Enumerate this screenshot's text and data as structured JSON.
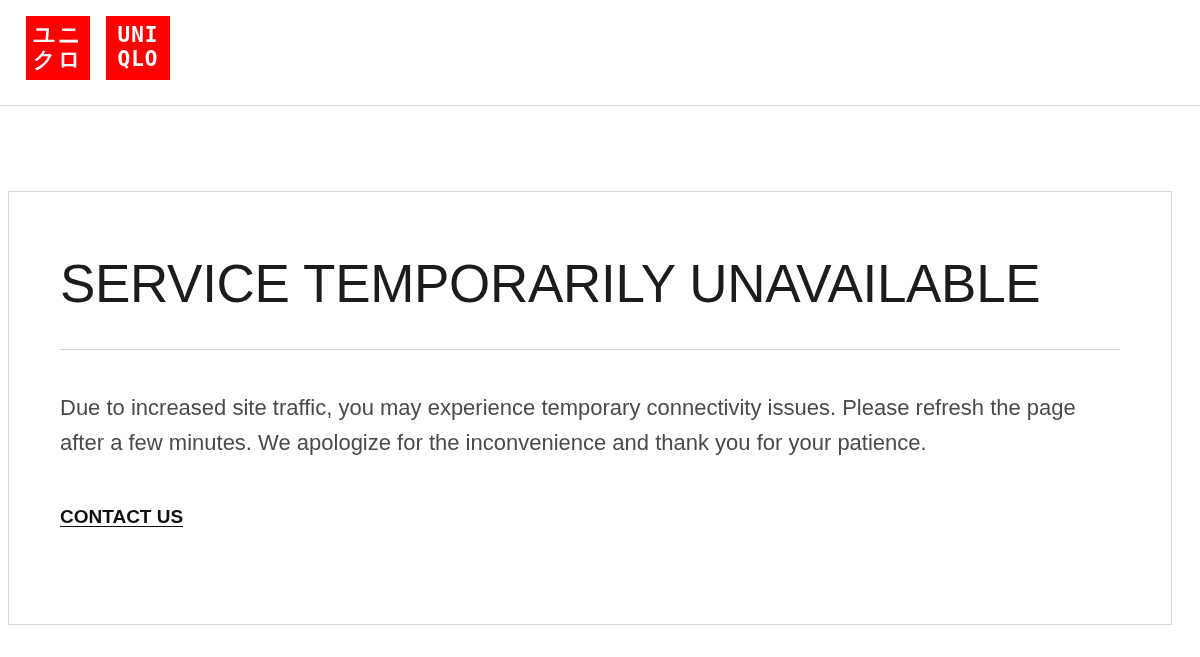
{
  "header": {
    "logo": {
      "katakana_lines": [
        "ユニ",
        "クロ"
      ],
      "latin_lines": [
        "UNI",
        "QLO"
      ]
    }
  },
  "notice": {
    "title": "SERVICE TEMPORARILY UNAVAILABLE",
    "message": "Due to increased site traffic, you may experience temporary connectivity issues. Please refresh the page after a few minutes. We apologize for the inconvenience and thank you for your patience.",
    "link": "CONTACT US"
  }
}
